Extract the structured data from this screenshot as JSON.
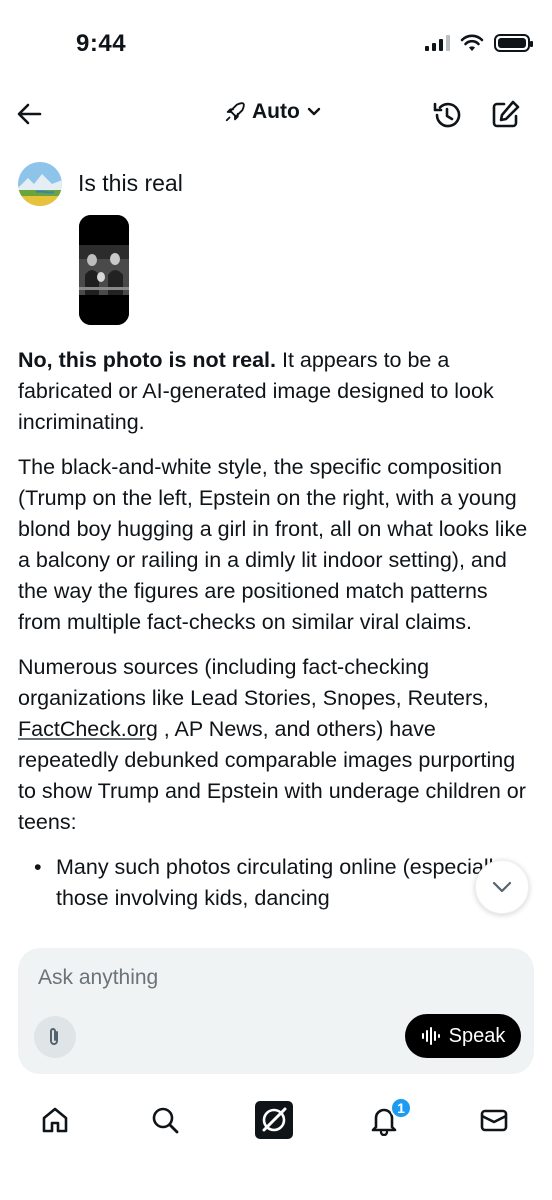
{
  "status_bar": {
    "time": "9:44"
  },
  "header": {
    "model_label": "Auto"
  },
  "user_message": {
    "text": "Is this real"
  },
  "answer": {
    "p1_bold": "No, this photo is not real.",
    "p1_rest": " It appears to be a fabricated or AI-generated image designed to look incriminating.",
    "p2": "The black-and-white style, the specific composition (Trump on the left, Epstein on the right, with a young blond boy hugging a girl in front, all on what looks like a balcony or railing in a dimly lit indoor setting), and the way the figures are positioned match patterns from multiple fact-checks on similar viral claims.",
    "p3_start": "Numerous sources (including fact-checking organizations like Lead Stories, Snopes, Reuters, ",
    "p3_link": "FactCheck.org",
    "p3_end": " , AP News, and others) have repeatedly debunked comparable images purporting to show Trump and Epstein with underage children or teens:",
    "bullet1": "Many such photos circulating online (especially those involving kids, dancing"
  },
  "composer": {
    "placeholder": "Ask anything",
    "speak_label": "Speak"
  },
  "nav": {
    "notifications_badge": "1"
  }
}
